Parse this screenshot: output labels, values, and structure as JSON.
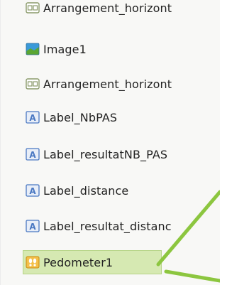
{
  "components": [
    {
      "label": "Arrangement_horizont",
      "icon": "horizontal-arrangement-icon"
    },
    {
      "label": "Image1",
      "icon": "image-icon"
    },
    {
      "label": "Arrangement_horizont",
      "icon": "horizontal-arrangement-icon"
    },
    {
      "label": "Label_NbPAS",
      "icon": "label-icon"
    },
    {
      "label": "Label_resultatNB_PAS",
      "icon": "label-icon"
    },
    {
      "label": "Label_distance",
      "icon": "label-icon"
    },
    {
      "label": "Label_resultat_distanc",
      "icon": "label-icon"
    },
    {
      "label": "Pedometer1",
      "icon": "pedometer-icon",
      "selected": true
    }
  ],
  "colors": {
    "selection_fill": "#d6e9b2",
    "selection_border": "#b6d486",
    "annotation_line": "#8cc63f",
    "label_icon": "#4a78c2",
    "image_icon_sky": "#3a9ad9",
    "image_icon_grass": "#5aa632",
    "pedometer_icon": "#e8a020"
  }
}
